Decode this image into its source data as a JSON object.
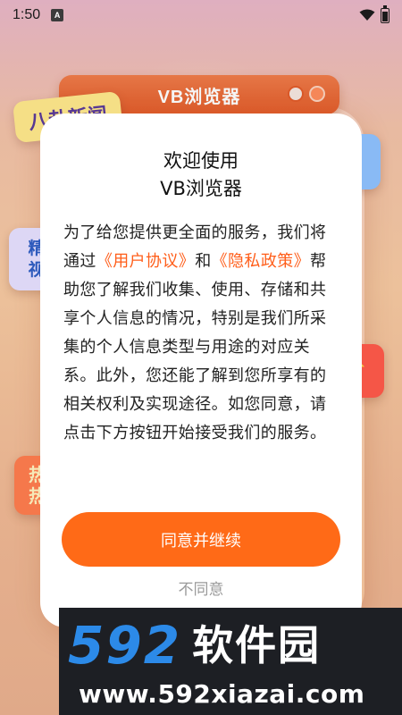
{
  "status_bar": {
    "time": "1:50",
    "notification_badge": "A",
    "icons": [
      "wifi-icon",
      "battery-icon"
    ]
  },
  "background": {
    "app_banner": "VB浏览器",
    "tag_news": "八卦新闻",
    "tag_video_line1": "精",
    "tag_video_line2": "视",
    "tag_hot_line1": "热",
    "tag_hot_line2": "热"
  },
  "dialog": {
    "title_line1": "欢迎使用",
    "title_line2": "VB浏览器",
    "body": {
      "part1": "为了给您提供更全面的服务，我们将通过",
      "user_agreement_link": "《用户协议》",
      "and": "和",
      "privacy_policy_link": "《隐私政策》",
      "part2": "帮助您了解我们收集、使用、存储和共享个人信息的情况，特别是我们所采集的个人信息类型与用途的对应关系。此外，您还能了解到您所享有的相关权利及实现途径。如您同意，请点击下方按钮开始接受我们的服务。"
    },
    "agree_button": "同意并继续",
    "disagree_button": "不同意"
  },
  "watermark": {
    "logo_number": "592",
    "logo_text": "软件园",
    "url": "www.592xiazai.com"
  },
  "colors": {
    "accent": "#ff6a17",
    "link": "#ff5e1a",
    "watermark_bg": "#1d1f24",
    "watermark_number": "#2c8ae8"
  }
}
